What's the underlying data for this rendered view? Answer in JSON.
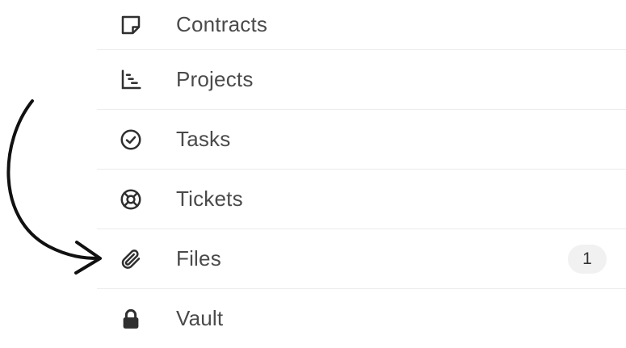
{
  "menu": {
    "items": [
      {
        "label": "Contracts",
        "icon": "note-icon"
      },
      {
        "label": "Projects",
        "icon": "gantt-icon"
      },
      {
        "label": "Tasks",
        "icon": "check-circle-icon"
      },
      {
        "label": "Tickets",
        "icon": "lifebuoy-icon"
      },
      {
        "label": "Files",
        "icon": "paperclip-icon",
        "badge": "1"
      },
      {
        "label": "Vault",
        "icon": "lock-icon"
      }
    ]
  },
  "colors": {
    "text": "#4a4a4a",
    "icon": "#2f2f2f",
    "badge_bg": "#f1f1f1",
    "divider": "#ececec"
  }
}
